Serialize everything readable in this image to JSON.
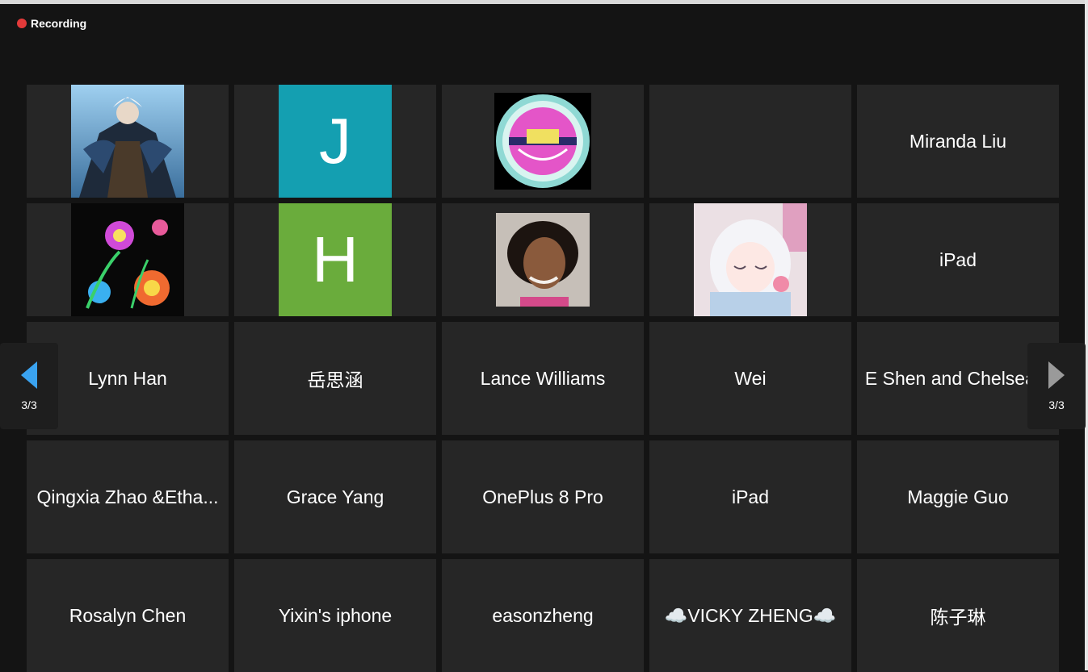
{
  "recording": {
    "label": "Recording"
  },
  "pager": {
    "left_label": "3/3",
    "right_label": "3/3"
  },
  "tiles": [
    {
      "type": "image",
      "icon": "warrior-avatar"
    },
    {
      "type": "letter",
      "letter": "J",
      "color": "#149fb1"
    },
    {
      "type": "image",
      "icon": "chinese-school-logo"
    },
    {
      "type": "empty"
    },
    {
      "type": "name",
      "name": "Miranda Liu"
    },
    {
      "type": "image",
      "icon": "neon-flowers-avatar"
    },
    {
      "type": "letter",
      "letter": "H",
      "color": "#6aac3c"
    },
    {
      "type": "image",
      "icon": "woman-photo"
    },
    {
      "type": "image",
      "icon": "anime-girl-avatar"
    },
    {
      "type": "name",
      "name": "iPad"
    },
    {
      "type": "name",
      "name": "Lynn Han"
    },
    {
      "type": "name",
      "name": "岳思涵"
    },
    {
      "type": "name",
      "name": "Lance Williams"
    },
    {
      "type": "name",
      "name": "Wei"
    },
    {
      "type": "name",
      "name": "E Shen and Chelsea..."
    },
    {
      "type": "name",
      "name": "Qingxia Zhao &Etha..."
    },
    {
      "type": "name",
      "name": "Grace Yang"
    },
    {
      "type": "name",
      "name": "OnePlus 8 Pro"
    },
    {
      "type": "name",
      "name": "iPad"
    },
    {
      "type": "name",
      "name": "Maggie Guo"
    },
    {
      "type": "name",
      "name": "Rosalyn Chen"
    },
    {
      "type": "name",
      "name": "Yixin's iphone"
    },
    {
      "type": "name",
      "name": "easonzheng"
    },
    {
      "type": "name",
      "name": "☁️VICKY ZHENG☁️"
    },
    {
      "type": "name",
      "name": "陈子琳"
    }
  ]
}
